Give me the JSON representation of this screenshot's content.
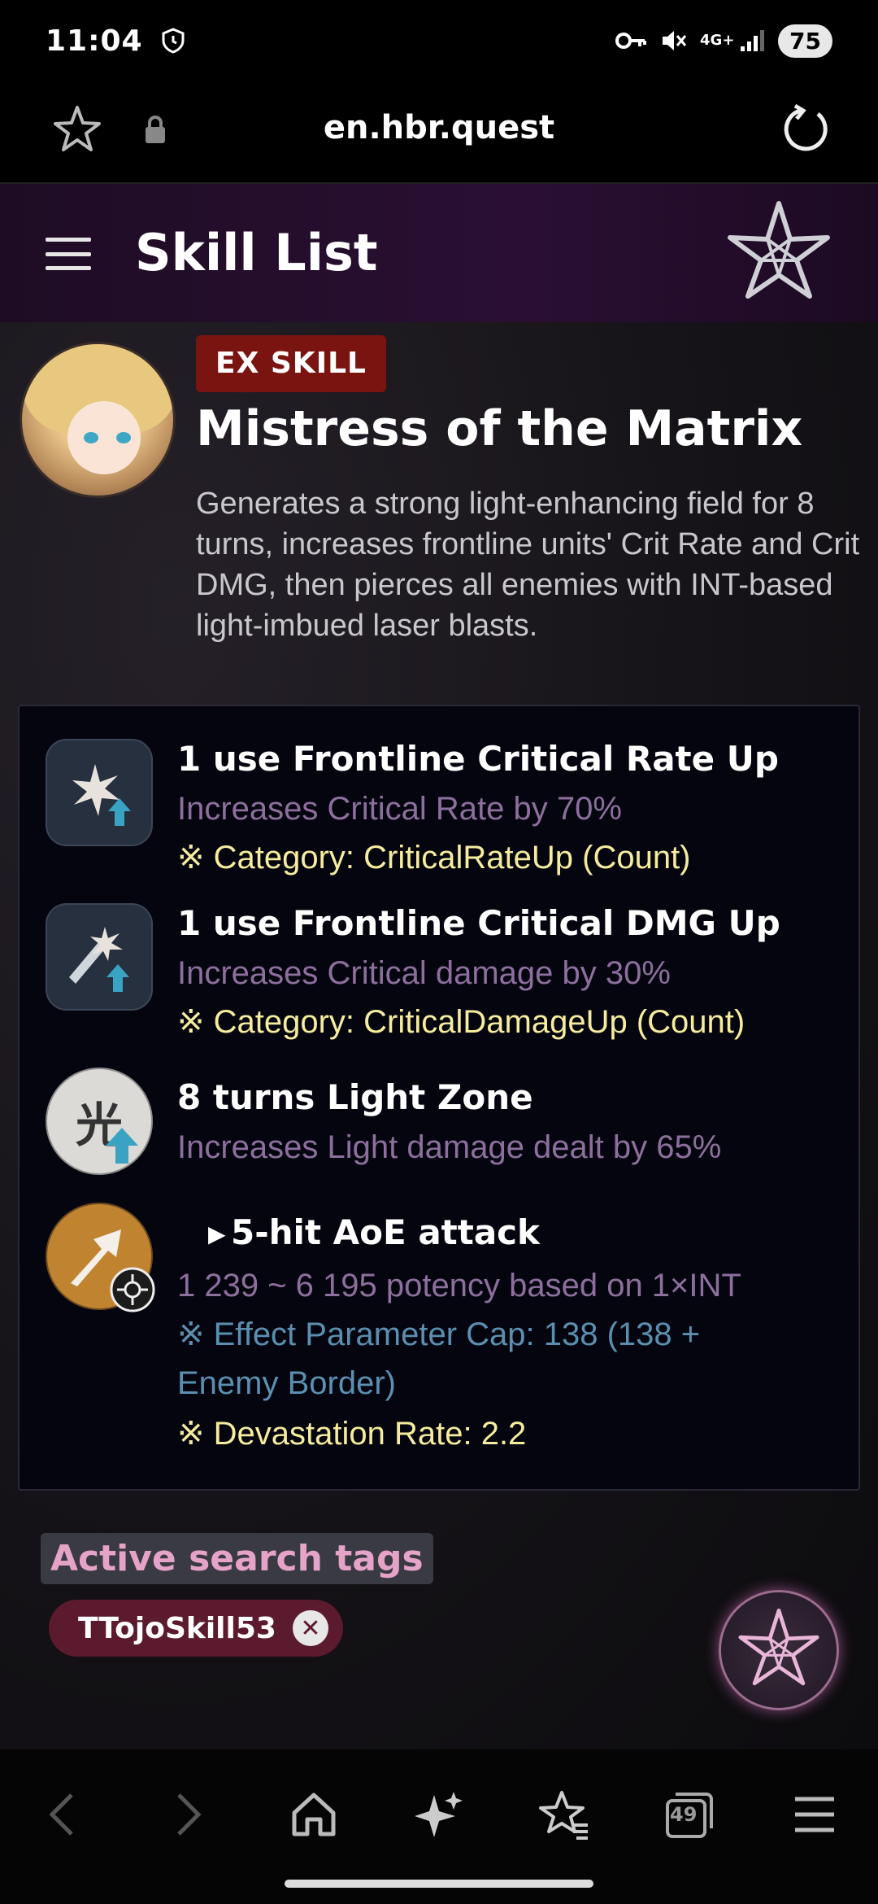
{
  "status_bar": {
    "time": "11:04",
    "battery": "75",
    "network": "4G+"
  },
  "browser": {
    "url": "en.hbr.quest"
  },
  "app_header": {
    "title": "Skill List"
  },
  "skill": {
    "badge": "EX SKILL",
    "name": "Mistress of the Matrix",
    "description": "Generates a strong light-enhancing field for 8 turns, increases frontline units' Crit Rate and Crit DMG, then pierces all enemies with INT-based light-imbued laser blasts."
  },
  "effects": [
    {
      "title": "1 use Frontline Critical Rate Up",
      "detail": "Increases Critical Rate by 70%",
      "category": "※ Category: CriticalRateUp (Count)",
      "icon": "critical-rate-up-icon"
    },
    {
      "title": "1 use Frontline Critical DMG Up",
      "detail": "Increases Critical damage by 30%",
      "category": "※ Category: CriticalDamageUp (Count)",
      "icon": "critical-damage-up-icon"
    },
    {
      "title": "8 turns Light Zone",
      "detail": "Increases Light damage dealt by 65%",
      "icon": "light-zone-icon",
      "icon_glyph": "光"
    },
    {
      "title": "5-hit AoE attack",
      "detail": "1 239 ~ 6 195 potency based on 1×INT",
      "cap_line1": "※ Effect Parameter Cap: 138 (138 +",
      "cap_line2": "Enemy Border)",
      "devastation": "※ Devastation Rate: 2.2",
      "icon": "aoe-attack-icon"
    }
  ],
  "search": {
    "label": "Active search tags",
    "tag": "TTojoSkill53",
    "close_glyph": "✕"
  },
  "bottom_nav": {
    "tab_count": "49"
  },
  "colors": {
    "header_bg": "#2a0f33",
    "badge_bg": "#7a1411",
    "detail_purple": "#8d6f9d",
    "category_yellow": "#f5ec9e",
    "cap_blue": "#5b8fb0",
    "tag_bg": "#5b1a2d",
    "tags_label_pink": "#e6a3c8"
  }
}
